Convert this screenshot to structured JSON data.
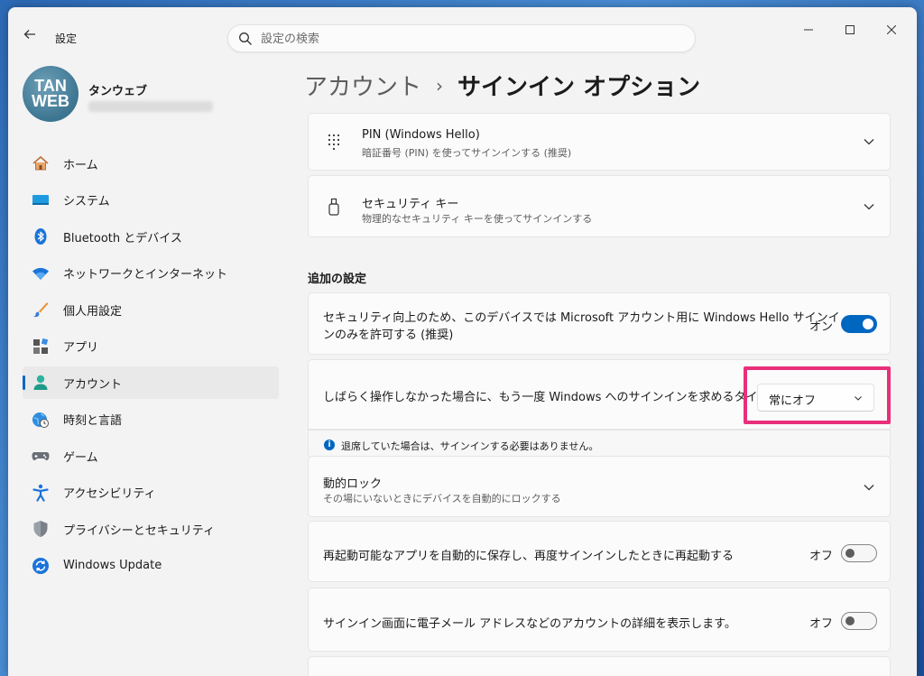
{
  "window": {
    "app_title": "設定"
  },
  "search": {
    "placeholder": "設定の検索"
  },
  "profile": {
    "avatar_line1": "TAN",
    "avatar_line2": "WEB",
    "name": "タンウェブ"
  },
  "sidebar": {
    "items": [
      {
        "label": "ホーム",
        "icon": "home-icon"
      },
      {
        "label": "システム",
        "icon": "system-icon"
      },
      {
        "label": "Bluetooth とデバイス",
        "icon": "bluetooth-icon"
      },
      {
        "label": "ネットワークとインターネット",
        "icon": "wifi-icon"
      },
      {
        "label": "個人用設定",
        "icon": "brush-icon"
      },
      {
        "label": "アプリ",
        "icon": "apps-icon"
      },
      {
        "label": "アカウント",
        "icon": "account-icon",
        "active": true
      },
      {
        "label": "時刻と言語",
        "icon": "time-language-icon"
      },
      {
        "label": "ゲーム",
        "icon": "gamepad-icon"
      },
      {
        "label": "アクセシビリティ",
        "icon": "accessibility-icon"
      },
      {
        "label": "プライバシーとセキュリティ",
        "icon": "shield-icon"
      },
      {
        "label": "Windows Update",
        "icon": "update-icon"
      }
    ]
  },
  "breadcrumb": {
    "parent": "アカウント",
    "separator": "›",
    "current": "サインイン オプション"
  },
  "cards": {
    "pin": {
      "title": "PIN (Windows Hello)",
      "subtitle": "暗証番号 (PIN) を使ってサインインする (推奨)"
    },
    "security_key": {
      "title": "セキュリティ キー",
      "subtitle": "物理的なセキュリティ キーを使ってサインインする"
    }
  },
  "additional": {
    "section_title": "追加の設定",
    "hello_only": {
      "text_line1": "セキュリティ向上のため、このデバイスでは Microsoft アカウント用に Windows Hello サインイ",
      "text_line2": "ンのみを許可する (推奨)",
      "state_label": "オン",
      "state": true
    },
    "timing": {
      "text": "しばらく操作しなかった場合に、もう一度 Windows へのサインインを求めるタイミング",
      "selected": "常にオフ",
      "info": "退席していた場合は、サインインする必要はありません。"
    },
    "dynamic_lock": {
      "title": "動的ロック",
      "subtitle": "その場にいないときにデバイスを自動的にロックする"
    },
    "restart_apps": {
      "text": "再起動可能なアプリを自動的に保存し、再度サインインしたときに再起動する",
      "state_label": "オフ",
      "state": false
    },
    "show_details": {
      "text": "サインイン画面に電子メール アドレスなどのアカウントの詳細を表示します。",
      "state_label": "オフ",
      "state": false
    }
  },
  "colors": {
    "accent": "#0067c0",
    "highlight": "#e8307a",
    "background": "#f3f3f3",
    "card": "#fbfbfb"
  }
}
